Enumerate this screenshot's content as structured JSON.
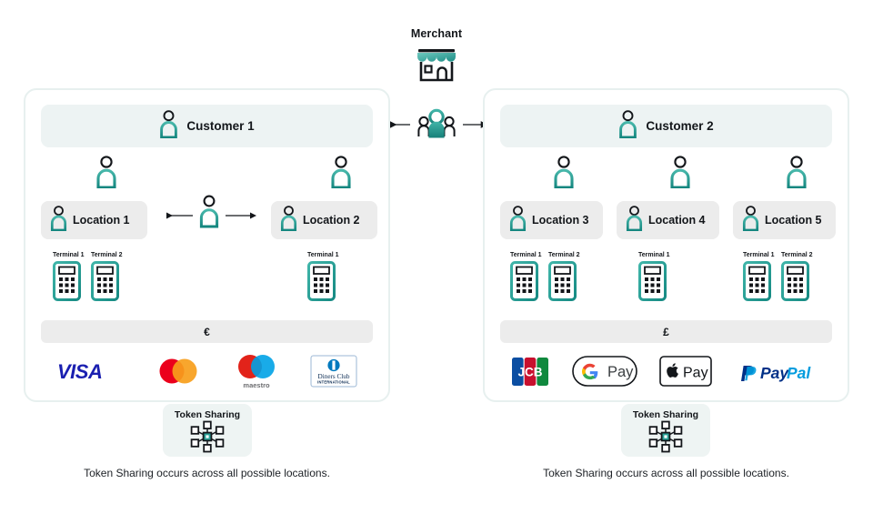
{
  "merchant": {
    "label": "Merchant",
    "icon": "storefront-icon",
    "group_icon": "people-group-icon",
    "arrow_left": "arrow-left-icon",
    "arrow_right": "arrow-right-icon"
  },
  "colors": {
    "teal": "#2aa398",
    "teal_dark": "#1d8d86",
    "teal_light": "#6fc9bf",
    "panel_border": "#e7f0ef",
    "customer_bar_bg": "#edf3f3",
    "location_bg": "#ececec",
    "token_bg": "#eef4f3",
    "text": "#13161a",
    "visa_blue": "#1a1fb0",
    "mc_red": "#eb001b",
    "mc_orange": "#f79e1b",
    "maestro_red": "#e2231a",
    "maestro_blue": "#00a2e5",
    "diners_blue": "#0079be",
    "jcb_blue": "#0b4ea2",
    "jcb_red": "#c8102e",
    "jcb_green": "#10893e",
    "paypal_blue": "#003087",
    "paypal_cyan": "#009cde"
  },
  "panels": [
    {
      "side": "left",
      "customer": {
        "label": "Customer 1",
        "icon": "person-icon"
      },
      "locations": [
        {
          "label": "Location 1",
          "icon": "person-icon",
          "terminals": [
            {
              "label": "Terminal 1"
            },
            {
              "label": "Terminal 2"
            }
          ]
        },
        {
          "label": "Location 2",
          "icon": "person-icon",
          "terminals": [
            {
              "label": "Terminal 1"
            }
          ]
        }
      ],
      "mid_person": {
        "icon": "person-icon",
        "arrow_left": "arrow-left-icon",
        "arrow_right": "arrow-right-icon"
      },
      "currency": "€",
      "payment_methods": [
        {
          "name": "VISA",
          "icon": "visa-logo"
        },
        {
          "name": "Mastercard",
          "icon": "mastercard-logo"
        },
        {
          "name": "maestro",
          "icon": "maestro-logo"
        },
        {
          "name": "Diners Club INTERNATIONAL",
          "icon": "diners-club-logo"
        }
      ],
      "token": {
        "title": "Token Sharing",
        "icon": "token-sharing-network-icon"
      },
      "caption": "Token Sharing occurs across all possible locations."
    },
    {
      "side": "right",
      "customer": {
        "label": "Customer 2",
        "icon": "person-icon"
      },
      "locations": [
        {
          "label": "Location 3",
          "icon": "person-icon",
          "terminals": [
            {
              "label": "Terminal 1"
            },
            {
              "label": "Terminal 2"
            }
          ]
        },
        {
          "label": "Location 4",
          "icon": "person-icon",
          "terminals": [
            {
              "label": "Terminal 1"
            }
          ]
        },
        {
          "label": "Location 5",
          "icon": "person-icon",
          "terminals": [
            {
              "label": "Terminal 1"
            },
            {
              "label": "Terminal 2"
            }
          ]
        }
      ],
      "currency": "£",
      "payment_methods": [
        {
          "name": "JCB",
          "icon": "jcb-logo"
        },
        {
          "name": "G Pay",
          "icon": "google-pay-logo"
        },
        {
          "name": "Apple Pay",
          "icon": "apple-pay-logo"
        },
        {
          "name": "PayPal",
          "icon": "paypal-logo"
        }
      ],
      "token": {
        "title": "Token Sharing",
        "icon": "token-sharing-network-icon"
      },
      "caption": "Token Sharing occurs across all possible locations."
    }
  ]
}
